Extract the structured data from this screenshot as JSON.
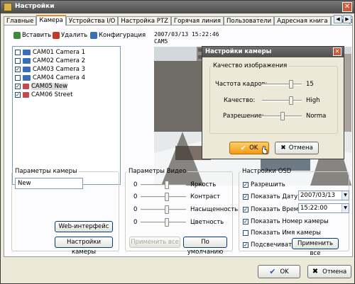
{
  "window": {
    "title": "Настройки"
  },
  "tabs": [
    "Главные",
    "Камера",
    "Устройства I/O",
    "Настройка PTZ",
    "Горячая линия",
    "Пользователи",
    "Адресная книга",
    "Отображени"
  ],
  "active_tab_index": 1,
  "toolbar": {
    "add_label": "Вставить",
    "delete_label": "Удалить",
    "config_label": "Конфигурация"
  },
  "cameras": [
    {
      "label": "CAM01 Camera 1",
      "checked": false,
      "icon": "camera-icon"
    },
    {
      "label": "CAM02 Camera 2",
      "checked": false,
      "icon": "camera-icon"
    },
    {
      "label": "CAM03 Camera 3",
      "checked": true,
      "icon": "camera-icon"
    },
    {
      "label": "CAM04 Camera 4",
      "checked": false,
      "icon": "camera-icon"
    },
    {
      "label": "CAM05 New",
      "checked": true,
      "icon": "network-camera-icon",
      "selected": true
    },
    {
      "label": "CAM06 Street",
      "checked": true,
      "icon": "network-camera-icon"
    }
  ],
  "video": {
    "timestamp": "2007/03/13 15:22:46",
    "camera_name": "CAM5"
  },
  "camera_params": {
    "legend": "Параметры камеры",
    "name_value": "New",
    "web_button": "Web-интерфейс",
    "settings_button": "Настройки камеры"
  },
  "video_params": {
    "legend": "Параметры Видео",
    "sliders": [
      {
        "label": "Яркость",
        "value_label": "0",
        "level": 0.58
      },
      {
        "label": "Контраст",
        "value_label": "0",
        "level": 0.58
      },
      {
        "label": "Насыщенность",
        "value_label": "0",
        "level": 0.58
      },
      {
        "label": "Цветность",
        "value_label": "0",
        "level": 0.58
      }
    ],
    "apply_button": "Применить все",
    "default_button": "По умолчанию"
  },
  "osd": {
    "legend": "Настройки OSD",
    "enable": {
      "label": "Разрешить",
      "checked": true
    },
    "show_date": {
      "label": "Показать Дату",
      "checked": true,
      "value": "2007/03/13"
    },
    "show_time": {
      "label": "Показать Время",
      "checked": true,
      "value": "15:22:00"
    },
    "show_cam_number": {
      "label": "Показать Номер камеры",
      "checked": true
    },
    "show_cam_name": {
      "label": "Показать Имя камеры",
      "checked": false
    },
    "highlight": {
      "label": "Подсвечивать",
      "checked": true
    },
    "apply_button": "Применить все"
  },
  "footer": {
    "ok_label": "OK",
    "cancel_label": "Отмена"
  },
  "dialog": {
    "title": "Настройки камеры",
    "group_legend": "Качество изображения",
    "rows": [
      {
        "label": "Частота кадров:",
        "value": "15",
        "level": 0.72
      },
      {
        "label": "Качество:",
        "value": "High",
        "level": 0.72
      },
      {
        "label": "Разрешение:",
        "value": "Norma",
        "level": 0.5
      }
    ],
    "ok_label": "OK",
    "cancel_label": "Отмена"
  },
  "colors": {
    "accent_tab": "#e68b2c",
    "ok_dialog": "#f6a21e",
    "title_bar": "#5a5a5a"
  }
}
